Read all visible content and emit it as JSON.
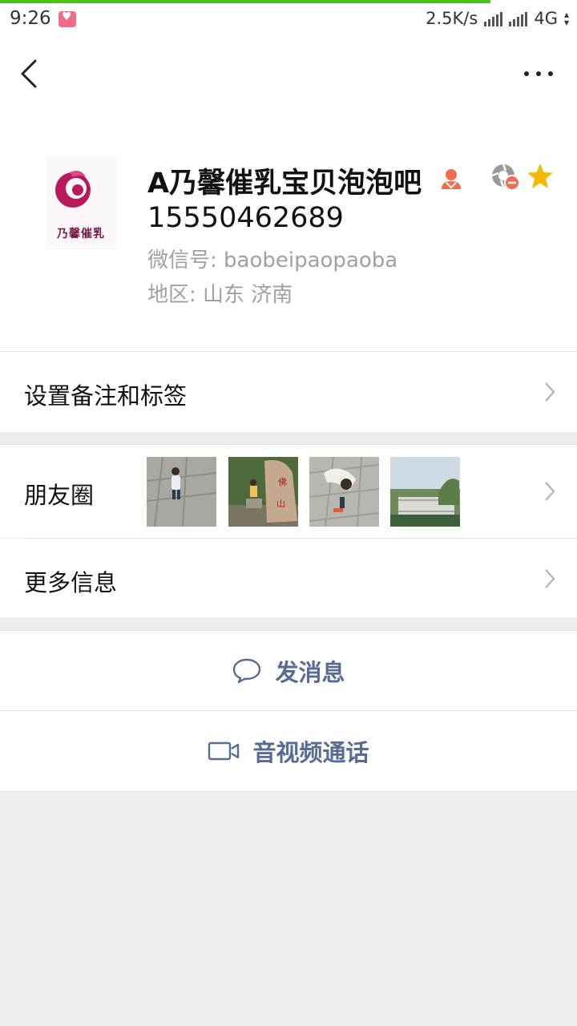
{
  "status_bar": {
    "time": "9:26",
    "network_speed": "2.5K/s",
    "network_type": "4G",
    "progress": 0.85
  },
  "top_bar": {
    "back_icon": "chevron-left-icon",
    "more_icon": "more-dots-icon"
  },
  "profile": {
    "avatar_text": "乃馨催乳",
    "name": "A乃馨催乳宝贝泡泡吧",
    "phone": "15550462689",
    "wechat_id": "微信号: baobeipaopaoba",
    "region": "地区: 山东  济南",
    "gender_icon": "female-icon",
    "moments_status_icon": "moments-blocked-icon",
    "star_icon": "star-icon",
    "star_color": "#f5b800"
  },
  "menu": {
    "remark_tags": "设置备注和标签",
    "moments": "朋友圈",
    "more_info": "更多信息"
  },
  "actions": {
    "send_message": "发消息",
    "video_call": "音视频通话",
    "accent_color": "#576b95"
  }
}
